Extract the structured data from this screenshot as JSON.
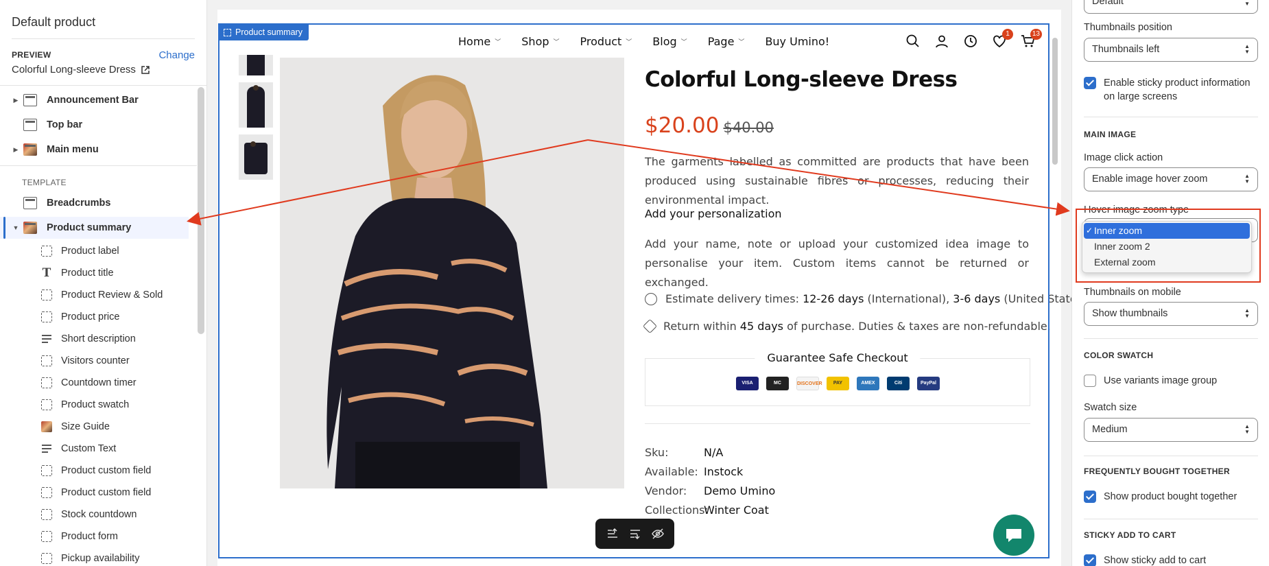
{
  "sidebar": {
    "title": "Default product",
    "preview_label": "PREVIEW",
    "change_label": "Change",
    "preview_value": "Colorful Long-sleeve Dress",
    "sections": [
      {
        "label": "Announcement Bar",
        "expandable": true
      },
      {
        "label": "Top bar",
        "expandable": false
      },
      {
        "label": "Main menu",
        "expandable": true
      }
    ],
    "template_label": "TEMPLATE",
    "template_items": [
      {
        "label": "Breadcrumbs"
      },
      {
        "label": "Product summary",
        "selected": true
      }
    ],
    "blocks": [
      {
        "label": "Product label",
        "icon": "dashed-square-icon"
      },
      {
        "label": "Product title",
        "icon": "text-icon"
      },
      {
        "label": "Product Review & Sold",
        "icon": "dashed-square-icon"
      },
      {
        "label": "Product price",
        "icon": "dashed-square-icon"
      },
      {
        "label": "Short description",
        "icon": "paragraph-icon"
      },
      {
        "label": "Visitors counter",
        "icon": "dashed-square-icon"
      },
      {
        "label": "Countdown timer",
        "icon": "dashed-square-icon"
      },
      {
        "label": "Product swatch",
        "icon": "dashed-square-icon"
      },
      {
        "label": "Size Guide",
        "icon": "image-icon"
      },
      {
        "label": "Custom Text",
        "icon": "paragraph-icon"
      },
      {
        "label": "Product custom field",
        "icon": "dashed-square-icon"
      },
      {
        "label": "Product custom field",
        "icon": "dashed-square-icon"
      },
      {
        "label": "Stock countdown",
        "icon": "dashed-square-icon"
      },
      {
        "label": "Product form",
        "icon": "dashed-square-icon"
      },
      {
        "label": "Pickup availability",
        "icon": "dashed-square-icon"
      }
    ]
  },
  "preview": {
    "selection_tag": "Product summary",
    "nav": [
      {
        "label": "Home",
        "dropdown": true
      },
      {
        "label": "Shop",
        "dropdown": true
      },
      {
        "label": "Product",
        "dropdown": true
      },
      {
        "label": "Blog",
        "dropdown": true
      },
      {
        "label": "Page",
        "dropdown": true
      },
      {
        "label": "Buy Umino!",
        "dropdown": false
      }
    ],
    "wishlist_count": "1",
    "cart_count": "13",
    "product": {
      "title": "Colorful Long-sleeve Dress",
      "price": "$20.00",
      "compare_price": "$40.00",
      "description": "The garments labelled as committed are products that have been produced using sustainable fibres or processes, reducing their environmental impact.",
      "personalization_heading": "Add your personalization",
      "personalization_text": "Add your name, note or upload your customized idea image to personalise your item. Custom items cannot be returned or exchanged.",
      "delivery": {
        "prefix": "Estimate delivery times: ",
        "intl": "12-26 days",
        "intl_suffix": " (International), ",
        "us": "3-6 days",
        "us_suffix": " (United States)."
      },
      "returns": {
        "prefix": "Return within ",
        "days": "45 days",
        "suffix": " of purchase. Duties & taxes are non-refundable."
      },
      "guarantee_title": "Guarantee Safe Checkout",
      "payments": [
        {
          "name": "VISA",
          "color": "#1a1f71"
        },
        {
          "name": "MC",
          "color": "#222222"
        },
        {
          "name": "DISCOVER",
          "color": "#f4f4f4"
        },
        {
          "name": "PAY",
          "color": "#f2c200"
        },
        {
          "name": "AMEX",
          "color": "#2e77bb"
        },
        {
          "name": "Citi",
          "color": "#003b70"
        },
        {
          "name": "PayPal",
          "color": "#253b80"
        }
      ],
      "meta": [
        {
          "key": "Sku:",
          "value": "N/A"
        },
        {
          "key": "Available:",
          "value": "Instock"
        },
        {
          "key": "Vendor:",
          "value": "Demo Umino"
        },
        {
          "key": "Collections:",
          "value": "Winter Coat"
        }
      ]
    }
  },
  "settings": {
    "top_select_value": "Default",
    "thumbnails_position_label": "Thumbnails position",
    "thumbnails_position_value": "Thumbnails left",
    "sticky_info_label": "Enable sticky product information on large screens",
    "main_image_section": "MAIN IMAGE",
    "image_click_label": "Image click action",
    "image_click_value": "Enable image hover zoom",
    "hover_zoom_label": "Hover image zoom type",
    "zoom_options": [
      "Inner zoom",
      "Inner zoom 2",
      "External zoom"
    ],
    "thumbnails_mobile_label": "Thumbnails on mobile",
    "thumbnails_mobile_value": "Show thumbnails",
    "color_swatch_section": "COLOR SWATCH",
    "variants_group_label": "Use variants image group",
    "swatch_size_label": "Swatch size",
    "swatch_size_value": "Medium",
    "fbt_section": "FREQUENTLY BOUGHT TOGETHER",
    "fbt_label": "Show product bought together",
    "sticky_cart_section": "STICKY ADD TO CART",
    "sticky_cart_label": "Show sticky add to cart"
  },
  "colors": {
    "accent": "#2c6ecb",
    "price_red": "#d9421c",
    "annotation_red": "#e03a1e",
    "chat_green": "#12866c"
  }
}
